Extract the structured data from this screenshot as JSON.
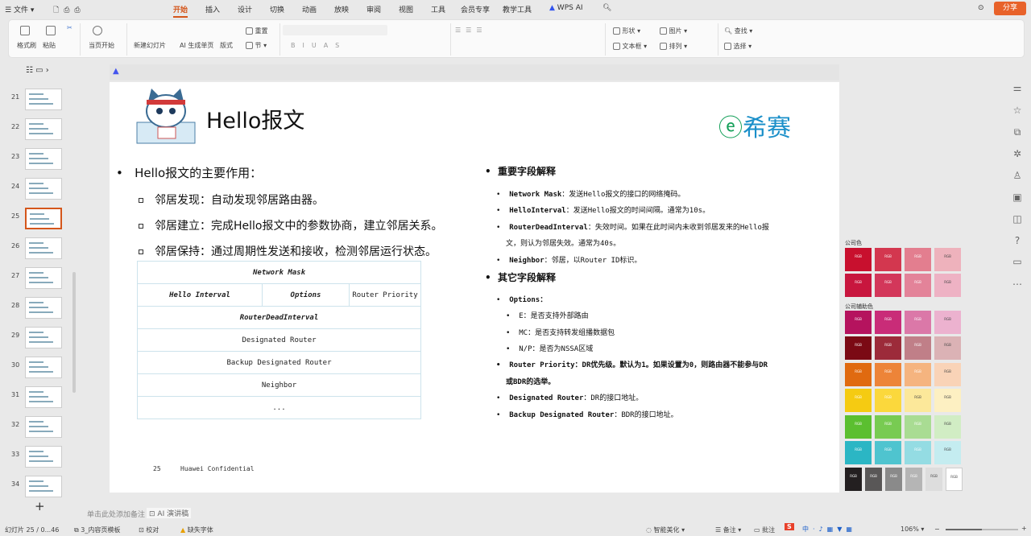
{
  "menu": {
    "file": "文件",
    "tabs": [
      "开始",
      "插入",
      "设计",
      "切换",
      "动画",
      "放映",
      "审阅",
      "视图",
      "工具",
      "会员专享",
      "教学工具"
    ],
    "wps_ai": "WPS AI",
    "share": "分享"
  },
  "ribbon": {
    "format_painter": "格式刷",
    "paste": "粘贴",
    "from_start": "当页开始",
    "new_slide": "新建幻灯片",
    "ai_page": "AI 生成单页",
    "layout": "版式",
    "reset": "重置",
    "section": "节",
    "shape": "形状",
    "picture": "图片",
    "textbox": "文本框",
    "arrange": "排列",
    "find": "查找",
    "select": "选择"
  },
  "thumbnails": {
    "numbers": [
      "21",
      "22",
      "23",
      "24",
      "25",
      "26",
      "27",
      "28",
      "29",
      "30",
      "31",
      "32",
      "33",
      "34"
    ],
    "selected": "25",
    "add": "+"
  },
  "slide": {
    "title": "Hello报文",
    "logo": "希赛",
    "main_bullet": "Hello报文的主要作用：",
    "sub_bullets": [
      "邻居发现：自动发现邻居路由器。",
      "邻居建立：完成Hello报文中的参数协商，建立邻居关系。",
      "邻居保持：通过周期性发送和接收，检测邻居运行状态。"
    ],
    "table": {
      "r1": "Network Mask",
      "r2a": "Hello Interval",
      "r2b": "Options",
      "r2c": "Router Priority",
      "r3": "RouterDeadInterval",
      "r4": "Designated Router",
      "r5": "Backup Designated Router",
      "r6": "Neighbor",
      "r7": "..."
    },
    "important_heading": "重要字段解释",
    "important": [
      {
        "k": "Network Mask",
        "v": "：发送Hello报文的接口的网络掩码。"
      },
      {
        "k": "HelloInterval",
        "v": "：发送Hello报文的时间间隔。通常为10s。"
      },
      {
        "k": "RouterDeadInterval",
        "v": "：失效时间。如果在此时间内未收到邻居发来的Hello报"
      },
      {
        "k": "",
        "v": "文，则认为邻居失效。通常为40s。"
      },
      {
        "k": "Neighbor",
        "v": "：邻居，以Router ID标识。"
      }
    ],
    "other_heading": "其它字段解释",
    "options_label": "Options：",
    "options": [
      "E：是否支持外部路由",
      "MC：是否支持转发组播数据包",
      "N/P：是否为NSSA区域"
    ],
    "priority_1": "Router Priority：DR优先级。默认为1。如果设置为0，则路由器不能参与DR",
    "priority_2": "或BDR的选举。",
    "dr": {
      "k": "Designated Router",
      "v": "：DR的接口地址。"
    },
    "bdr": {
      "k": "Backup Designated Router",
      "v": "：BDR的接口地址。"
    },
    "footer_num": "25",
    "footer_text": "Huawei Confidential"
  },
  "palette": {
    "company": "公司色",
    "aux": "公司辅助色",
    "rgb": "RGB",
    "rows": [
      [
        "#c8102e",
        "#d3374f",
        "#e37e8f",
        "#eeb2bc"
      ],
      [
        "#c8163e",
        "#d3375a",
        "#e38399",
        "#eeb2c4"
      ],
      [
        "#b5135e",
        "#c92c78",
        "#db78a8",
        "#ecb2cf"
      ],
      [
        "#7b0a14",
        "#9c2b3a",
        "#c07f88",
        "#dbb2b5"
      ],
      [
        "#e06a10",
        "#ed8438",
        "#f5b47f",
        "#f9d3b7"
      ],
      [
        "#f5cb12",
        "#fbd83c",
        "#fce89a",
        "#fdf0c2"
      ],
      [
        "#5bbf30",
        "#78cb52",
        "#a9dc93",
        "#d1edc4"
      ],
      [
        "#2bb6c4",
        "#4fc4cf",
        "#94dce3",
        "#c4ecf0"
      ],
      [
        "#231f20",
        "#595757",
        "#8a8a8a",
        "#b5b5b5",
        "#dddddd",
        "#ffffff"
      ]
    ]
  },
  "notes": {
    "placeholder": "单击此处添加备注",
    "ai": "AI 演讲稿"
  },
  "status": {
    "slide": "幻灯片 25 / 0...46",
    "template": "3_内容页模板",
    "proof": "校对",
    "font_missing": "缺失字体",
    "beautify": "智能美化",
    "notes": "备注",
    "comments": "批注",
    "zoom": "106%"
  }
}
